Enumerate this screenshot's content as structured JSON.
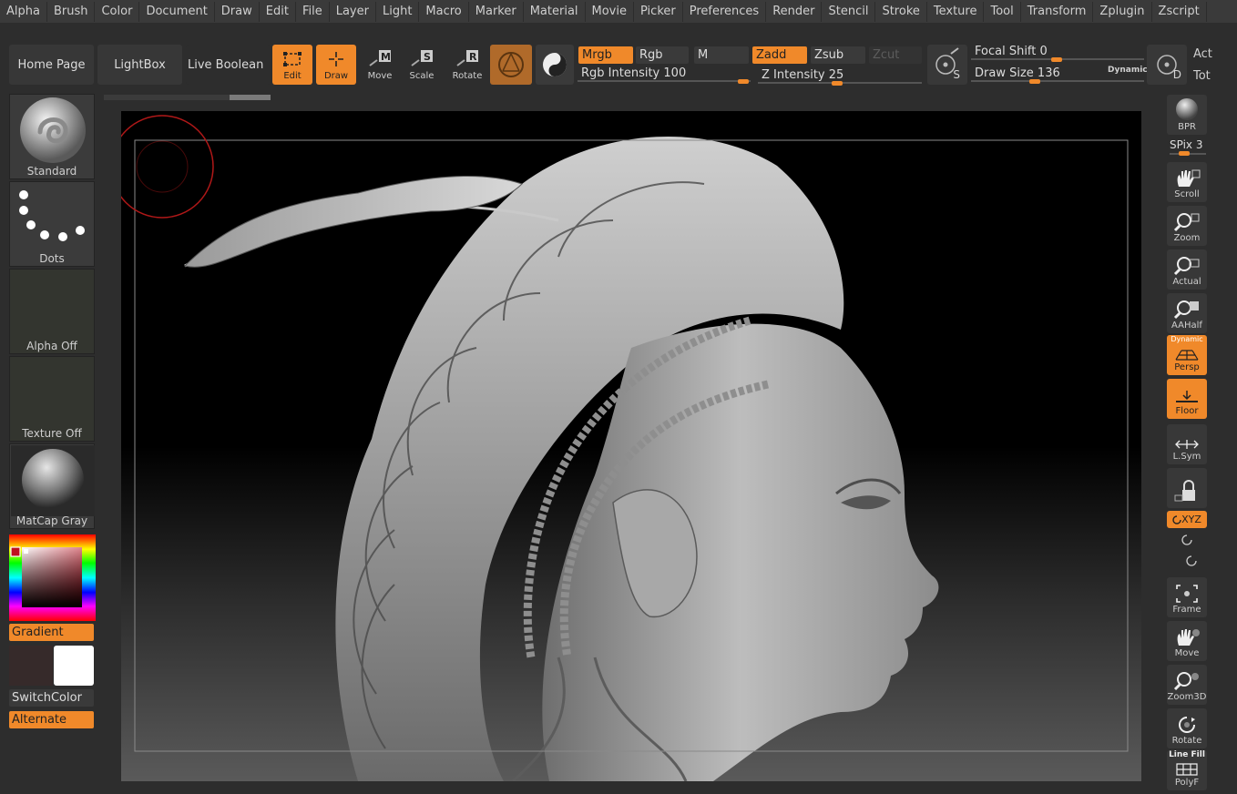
{
  "menu": [
    "Alpha",
    "Brush",
    "Color",
    "Document",
    "Draw",
    "Edit",
    "File",
    "Layer",
    "Light",
    "Macro",
    "Marker",
    "Material",
    "Movie",
    "Picker",
    "Preferences",
    "Render",
    "Stencil",
    "Stroke",
    "Texture",
    "Tool",
    "Transform",
    "Zplugin",
    "Zscript"
  ],
  "toolbar": {
    "home_page": "Home Page",
    "lightbox": "LightBox",
    "live_boolean": "Live Boolean",
    "edit": "Edit",
    "draw": "Draw",
    "move": "Move",
    "scale": "Scale",
    "rotate": "Rotate",
    "mrgb": "Mrgb",
    "rgb": "Rgb",
    "m": "M",
    "zadd": "Zadd",
    "zsub": "Zsub",
    "zcut": "Zcut",
    "rgb_intensity_label": "Rgb Intensity",
    "rgb_intensity_value": "100",
    "z_intensity_label": "Z Intensity",
    "z_intensity_value": "25",
    "focal_shift_label": "Focal Shift",
    "focal_shift_value": "0",
    "draw_size_label": "Draw Size",
    "draw_size_value": "136",
    "dynamic": "Dynamic",
    "act": "Act",
    "tot": "Tot",
    "s_label": "S",
    "d_label": "D"
  },
  "left_shelf": {
    "brush": "Standard",
    "stroke": "Dots",
    "alpha": "Alpha Off",
    "texture": "Texture Off",
    "material": "MatCap Gray",
    "gradient": "Gradient",
    "switch_color": "SwitchColor",
    "alternate": "Alternate"
  },
  "right_shelf": {
    "bpr": "BPR",
    "spix_label": "SPix",
    "spix_value": "3",
    "scroll": "Scroll",
    "zoom": "Zoom",
    "actual": "Actual",
    "aahalf": "AAHalf",
    "dynamic": "Dynamic",
    "persp": "Persp",
    "floor": "Floor",
    "lsym": "L.Sym",
    "xyz": "XYZ",
    "frame": "Frame",
    "move": "Move",
    "zoom3d": "Zoom3D",
    "rotate": "Rotate",
    "line_fill": "Line Fill",
    "polyf": "PolyF"
  },
  "colors": {
    "accent": "#f0892a",
    "background": "#2d2d2d",
    "brush_cursor": "#b01818"
  },
  "progress": {
    "rgb_intensity": 1.0,
    "z_intensity": 0.25
  }
}
